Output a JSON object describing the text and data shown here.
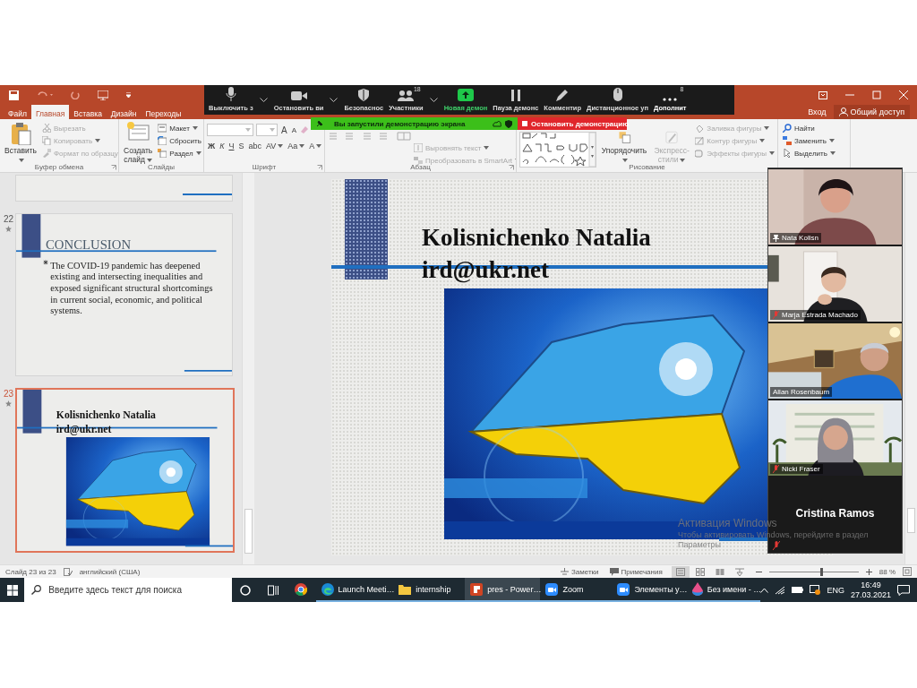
{
  "ribbon_tabs": [
    {
      "label": "Файл",
      "selected": false
    },
    {
      "label": "Главная",
      "selected": true
    },
    {
      "label": "Вставка",
      "selected": false
    },
    {
      "label": "Дизайн",
      "selected": false
    },
    {
      "label": "Переходы",
      "selected": false
    }
  ],
  "account": {
    "sign_in": "Вход",
    "share": "Общий доступ"
  },
  "ribbon_groups": [
    {
      "title": "Буфер обмена",
      "kind": "clipboard",
      "items": [
        {
          "label": "Вставить",
          "kind": "large",
          "disabled": false,
          "dropdown": true
        },
        {
          "label": "Вырезать",
          "kind": "small",
          "disabled": true,
          "dropdown": false
        },
        {
          "label": "Копировать",
          "kind": "small",
          "disabled": true,
          "dropdown": true
        },
        {
          "label": "Формат по образцу",
          "kind": "small",
          "disabled": true,
          "dropdown": false
        }
      ]
    },
    {
      "title": "Слайды",
      "kind": "slides",
      "items": [
        {
          "label": "Создать слайд",
          "kind": "large",
          "disabled": false,
          "dropdown": true
        },
        {
          "label": "Макет",
          "kind": "small",
          "disabled": false,
          "dropdown": true
        },
        {
          "label": "Сбросить",
          "kind": "small",
          "disabled": false,
          "dropdown": false
        },
        {
          "label": "Раздел",
          "kind": "small",
          "disabled": false,
          "dropdown": true
        }
      ]
    },
    {
      "title": "Шрифт",
      "kind": "font",
      "size_buttons": [
        "A",
        "A"
      ],
      "format_buttons": [
        {
          "label": "Ж",
          "dropdown": false
        },
        {
          "label": "К",
          "dropdown": false
        },
        {
          "label": "Ч",
          "dropdown": false
        },
        {
          "label": "S",
          "dropdown": false
        },
        {
          "label": "abc",
          "dropdown": false
        },
        {
          "label": "AV",
          "dropdown": true
        },
        {
          "label": "Aa",
          "dropdown": true
        },
        {
          "label": "A",
          "dropdown": true
        }
      ]
    },
    {
      "title": "Абзац",
      "kind": "paragraph",
      "items": [
        {
          "label": "Выровнять текст",
          "kind": "small",
          "disabled": true,
          "dropdown": true
        },
        {
          "label": "Преобразовать в SmartArt",
          "kind": "small",
          "disabled": true,
          "dropdown": true
        }
      ]
    },
    {
      "title": "Рисование",
      "kind": "drawing",
      "items": [
        {
          "kind": "gallery"
        },
        {
          "label": "Упорядочить",
          "kind": "large",
          "disabled": false,
          "dropdown": true
        },
        {
          "label": "Экспресс-стили",
          "kind": "large",
          "disabled": true,
          "dropdown": true
        },
        {
          "label": "Заливка фигуры",
          "kind": "small",
          "disabled": true,
          "dropdown": true
        },
        {
          "label": "Контур фигуры",
          "kind": "small",
          "disabled": true,
          "dropdown": true
        },
        {
          "label": "Эффекты фигуры",
          "kind": "small",
          "disabled": true,
          "dropdown": true
        }
      ]
    },
    {
      "kind": "editing",
      "items": [
        {
          "label": "Найти",
          "kind": "small",
          "disabled": false,
          "dropdown": false
        },
        {
          "label": "Заменить",
          "kind": "small",
          "disabled": false,
          "dropdown": true
        },
        {
          "label": "Выделить",
          "kind": "small",
          "disabled": false,
          "dropdown": true
        }
      ]
    }
  ],
  "zoom_toolbar": {
    "items": [
      {
        "label": "Выключить з",
        "kind": "mic",
        "dropdown": true
      },
      {
        "label": "Остановить ви",
        "kind": "camera",
        "dropdown": true
      },
      {
        "label": "Безопаснос",
        "kind": "shield",
        "dropdown": false
      },
      {
        "label": "Участники",
        "kind": "participants",
        "badge": "18",
        "dropdown": true
      },
      {
        "label": "Новая демон",
        "kind": "share",
        "dropdown": false
      },
      {
        "label": "Пауза демонс",
        "kind": "pause",
        "dropdown": false
      },
      {
        "label": "Комментир",
        "kind": "annotate",
        "dropdown": false
      },
      {
        "label": "Дистанционное уп",
        "kind": "remote",
        "dropdown": false
      },
      {
        "label": "Дополнит",
        "kind": "more",
        "badge": "8",
        "dropdown": false
      }
    ]
  },
  "sharing_banner": {
    "message": "Вы запустили демонстрацию экрана",
    "stop": "Остановить демонстрацию"
  },
  "slides_pane": [
    {
      "kind": "partial",
      "selected": false
    },
    {
      "number": "22",
      "kind": "bullets",
      "title": "CONCLUSION",
      "bullets": [
        "The COVID-19 pandemic has deepened existing and intersecting inequalities and exposed significant structural shortcomings in current social, economic, and political systems."
      ],
      "selected": false
    },
    {
      "number": "23",
      "kind": "contact",
      "title": "Kolisnichenko Natalia",
      "subtitle": "ird@ukr.net",
      "selected": true
    }
  ],
  "main_slide": {
    "kind": "contact",
    "title": "Kolisnichenko Natalia",
    "subtitle": "ird@ukr.net"
  },
  "video_panel": {
    "tiles": [
      {
        "name": "Nata Kolisn",
        "pinned": true,
        "muted": false
      },
      {
        "name": "Marja Estrada Machado",
        "pinned": false,
        "muted": true
      },
      {
        "name": "Allan Rosenbaum",
        "pinned": false,
        "muted": false
      },
      {
        "name": "Nicki Fraser",
        "pinned": false,
        "muted": true
      }
    ],
    "speaker": {
      "name": "Cristina Ramos",
      "muted": true
    }
  },
  "activation": {
    "title": "Активация Windows",
    "message": "Чтобы активировать Windows, перейдите в раздел",
    "link": "Параметры"
  },
  "status_bar": {
    "slide_info": "Слайд 23 из 23",
    "language": "английский (США)",
    "notes": "Заметки",
    "comments": "Примечания",
    "views": [
      {
        "selected": true
      },
      {
        "selected": false
      },
      {
        "selected": false
      },
      {
        "selected": false
      }
    ],
    "zoom": {
      "level": 0.58,
      "reading": "88 %"
    }
  },
  "taskbar": {
    "search": {
      "placeholder": "Введите здесь текст для поиска"
    },
    "apps": [
      {
        "kind": "chrome",
        "selected": false,
        "running": false
      },
      {
        "kind": "edge",
        "label": "Launch Meeti…",
        "selected": false,
        "running": true
      },
      {
        "kind": "folder",
        "label": "internship",
        "selected": false,
        "running": true
      },
      {
        "kind": "powerpoint",
        "label": "pres - Power…",
        "selected": true,
        "running": true
      },
      {
        "kind": "zoom",
        "label": "Zoom",
        "selected": false,
        "running": true
      },
      {
        "kind": "zoom",
        "label": "Элементы у…",
        "selected": false,
        "running": true
      },
      {
        "kind": "paint",
        "label": "Без имени - …",
        "selected": false,
        "running": true
      }
    ],
    "language": "ENG",
    "time": "16:49",
    "date": "27.03.2021"
  }
}
